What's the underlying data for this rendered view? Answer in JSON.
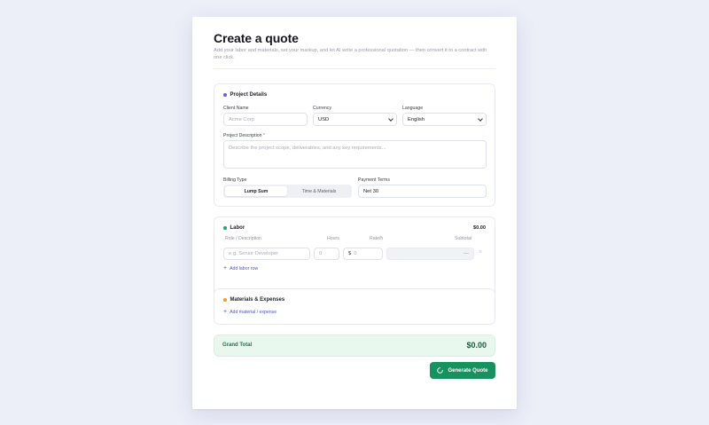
{
  "header": {
    "title": "Create a quote",
    "subtitle": "Add your labor and materials, set your markup, and let AI write a professional quotation — then convert it to a contract with one click."
  },
  "project": {
    "heading": "Project Details",
    "client_label": "Client Name",
    "client_placeholder": "Acme Corp",
    "currency_label": "Currency",
    "currency_value": "USD",
    "language_label": "Language",
    "language_value": "English",
    "description_label": "Project Description",
    "required_mark": "*",
    "description_placeholder": "Describe the project scope, deliverables, and any key requirements...",
    "billing_label": "Billing Type",
    "billing_options": [
      "Lump Sum",
      "Time & Materials"
    ],
    "billing_selected": "Lump Sum",
    "terms_label": "Payment Terms",
    "terms_value": "Net 30"
  },
  "labor": {
    "heading": "Labor",
    "total": "$0.00",
    "col_role": "Role / Description",
    "col_hours": "Hours",
    "col_rate": "Rate/h",
    "col_subtotal": "Subtotal",
    "row": {
      "role_placeholder": "e.g. Senior Developer",
      "hours_placeholder": "0",
      "rate_prefix": "$",
      "rate_placeholder": "0",
      "subtotal": "—",
      "remove": "×"
    },
    "add_label": "Add labor row"
  },
  "materials": {
    "heading": "Materials & Expenses",
    "add_label": "Add material / expense"
  },
  "totals": {
    "label": "Grand Total",
    "value": "$0.00"
  },
  "actions": {
    "generate_label": "Generate Quote"
  },
  "colors": {
    "accent": "#4a55c9",
    "project_dot": "#6b63d9",
    "labor_dot": "#20a86a",
    "materials_dot": "#f0a22a",
    "button": "#17915d",
    "total_bg": "#e8f8ef"
  }
}
